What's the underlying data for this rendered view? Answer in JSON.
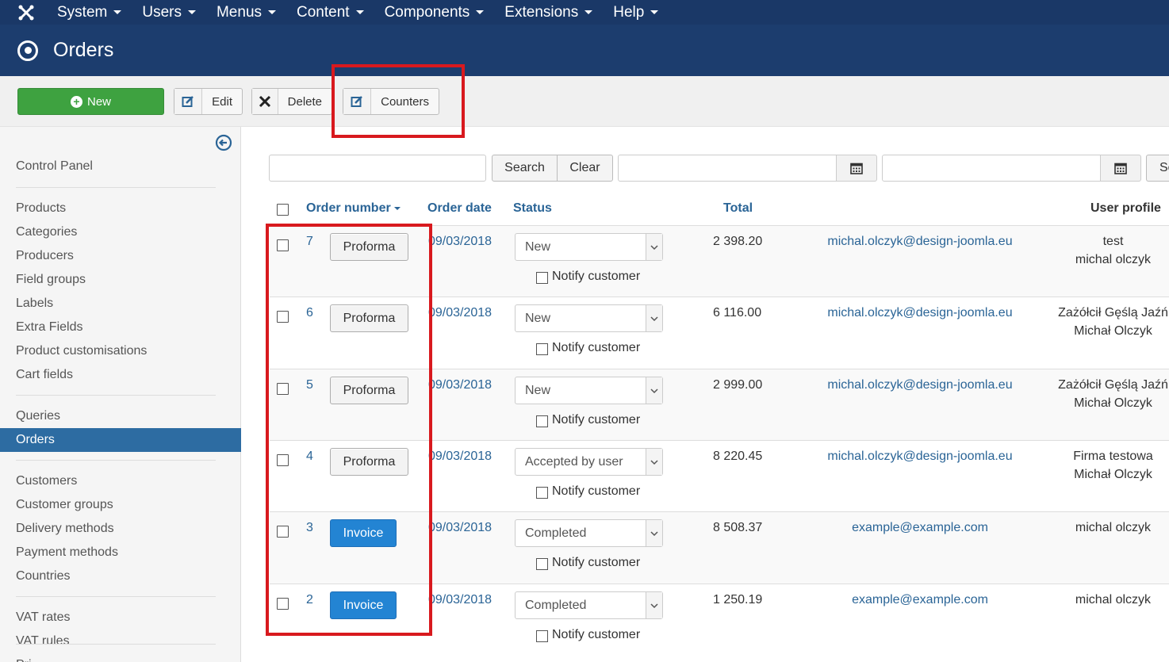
{
  "topnav": {
    "menu": [
      {
        "label": "System"
      },
      {
        "label": "Users"
      },
      {
        "label": "Menus"
      },
      {
        "label": "Content"
      },
      {
        "label": "Components"
      },
      {
        "label": "Extensions"
      },
      {
        "label": "Help"
      }
    ]
  },
  "header": {
    "title": "Orders"
  },
  "toolbar": {
    "new_label": "New",
    "edit_label": "Edit",
    "delete_label": "Delete",
    "counters_label": "Counters"
  },
  "sidebar": {
    "items": [
      {
        "label": "Control Panel"
      },
      {
        "label": "Products"
      },
      {
        "label": "Categories"
      },
      {
        "label": "Producers"
      },
      {
        "label": "Field groups"
      },
      {
        "label": "Labels"
      },
      {
        "label": "Extra Fields"
      },
      {
        "label": "Product customisations"
      },
      {
        "label": "Cart fields"
      },
      {
        "label": "Queries"
      },
      {
        "label": "Orders"
      },
      {
        "label": "Customers"
      },
      {
        "label": "Customer groups"
      },
      {
        "label": "Delivery methods"
      },
      {
        "label": "Payment methods"
      },
      {
        "label": "Countries"
      },
      {
        "label": "VAT rates"
      },
      {
        "label": "VAT rules"
      },
      {
        "label": "Pri"
      }
    ]
  },
  "filters": {
    "search_label": "Search",
    "clear_label": "Clear",
    "extra_label": "Se"
  },
  "table": {
    "headers": {
      "order_number": "Order number",
      "order_date": "Order date",
      "status": "Status",
      "total": "Total",
      "user_profile": "User profile"
    },
    "notify_label": "Notify customer",
    "rows": [
      {
        "number": "7",
        "doc": "Proforma",
        "date": "09/03/2018",
        "status": "New",
        "total": "2 398.20",
        "email": "michal.olczyk@design-joomla.eu",
        "profile1": "test",
        "profile2": "michal olczyk"
      },
      {
        "number": "6",
        "doc": "Proforma",
        "date": "09/03/2018",
        "status": "New",
        "total": "6 116.00",
        "email": "michal.olczyk@design-joomla.eu",
        "profile1": "Zażółcił Gęślą Jaźń",
        "profile2": "Michał Olczyk"
      },
      {
        "number": "5",
        "doc": "Proforma",
        "date": "09/03/2018",
        "status": "New",
        "total": "2 999.00",
        "email": "michal.olczyk@design-joomla.eu",
        "profile1": "Zażółcił Gęślą Jaźń",
        "profile2": "Michał Olczyk"
      },
      {
        "number": "4",
        "doc": "Proforma",
        "date": "09/03/2018",
        "status": "Accepted by user",
        "total": "8 220.45",
        "email": "michal.olczyk@design-joomla.eu",
        "profile1": "Firma testowa",
        "profile2": "Michał Olczyk"
      },
      {
        "number": "3",
        "doc": "Invoice",
        "date": "09/03/2018",
        "status": "Completed",
        "total": "8 508.37",
        "email": "example@example.com",
        "profile1": "michal olczyk",
        "profile2": ""
      },
      {
        "number": "2",
        "doc": "Invoice",
        "date": "09/03/2018",
        "status": "Completed",
        "total": "1 250.19",
        "email": "example@example.com",
        "profile1": "michal olczyk",
        "profile2": ""
      }
    ]
  },
  "colors": {
    "topnav_bg": "#1a3867",
    "header_bg": "#1c3d6e",
    "new_button": "#3ea240",
    "invoice_button": "#2384d3",
    "active_sidebar": "#2d6ca2",
    "highlight": "#d8191e",
    "link": "#2a6496"
  }
}
